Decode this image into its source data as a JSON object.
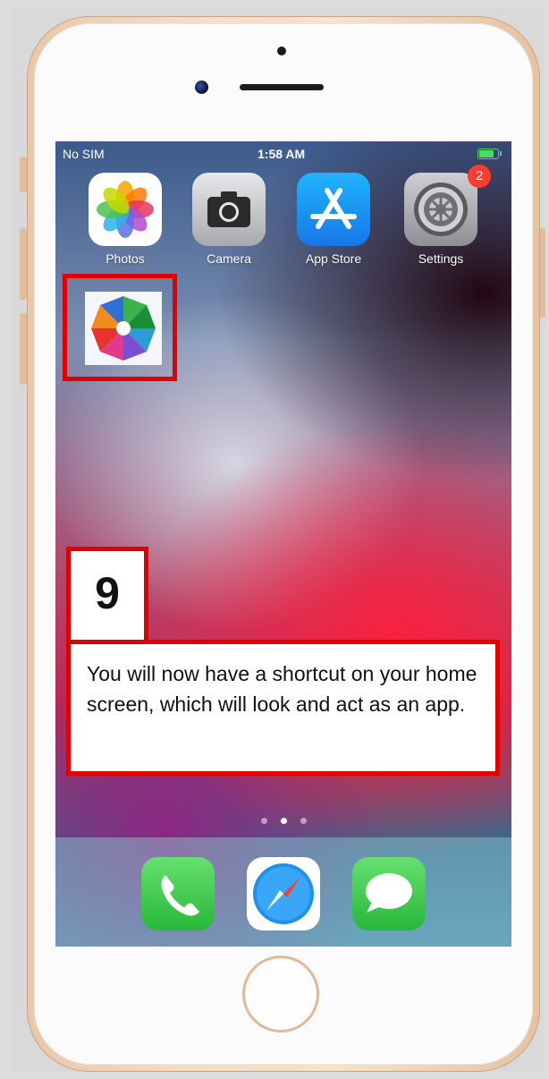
{
  "status_bar": {
    "carrier": "No SIM",
    "time": "1:58 AM"
  },
  "home_apps": [
    {
      "name": "Photos",
      "icon": "photos-icon"
    },
    {
      "name": "Camera",
      "icon": "camera-icon"
    },
    {
      "name": "App Store",
      "icon": "app-store-icon"
    },
    {
      "name": "Settings",
      "icon": "settings-gear-icon",
      "badge": "2"
    }
  ],
  "shortcut": {
    "icon": "shortcut-photos-icon"
  },
  "step": {
    "number": "9",
    "text": "You will now have a shortcut on your home screen, which will look and act as an app."
  },
  "page_dots": {
    "count": 3,
    "active": 1
  },
  "dock": [
    {
      "icon": "phone-icon"
    },
    {
      "icon": "safari-compass-icon"
    },
    {
      "icon": "messages-bubble-icon"
    }
  ],
  "colors": {
    "highlight_red": "#e10000",
    "badge_red": "#ff3b30",
    "frame_gold": "#f5dcc4"
  }
}
